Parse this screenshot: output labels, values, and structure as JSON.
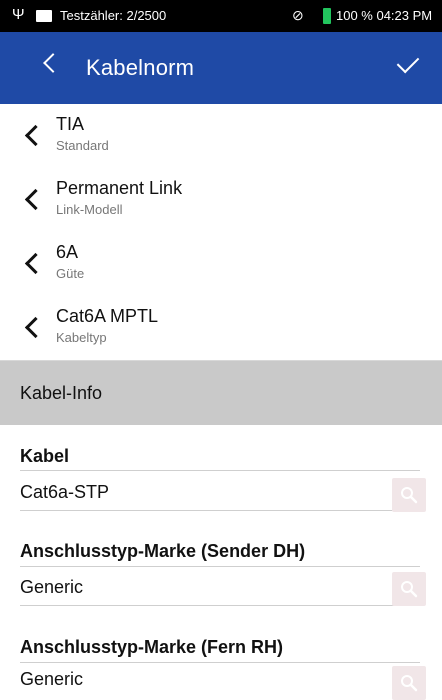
{
  "status": {
    "counter": "Testzähler: 2/2500",
    "battery_time": "100 % 04:23 PM",
    "battery_color": "#22c55e"
  },
  "header": {
    "title": "Kabelnorm",
    "color": "#1f4aa6"
  },
  "settings": [
    {
      "value": "TIA",
      "label": "Standard"
    },
    {
      "value": "Permanent Link",
      "label": "Link-Modell"
    },
    {
      "value": "6A",
      "label": "Güte"
    },
    {
      "value": "Cat6A MPTL",
      "label": "Kabeltyp"
    }
  ],
  "section": {
    "title": "Kabel-Info"
  },
  "fields": [
    {
      "title": "Kabel",
      "value": "Cat6a-STP"
    },
    {
      "title": "Anschlusstyp-Marke (Sender DH)",
      "value": "Generic"
    },
    {
      "title": "Anschlusstyp-Marke (Fern RH)",
      "value": "Generic"
    }
  ]
}
